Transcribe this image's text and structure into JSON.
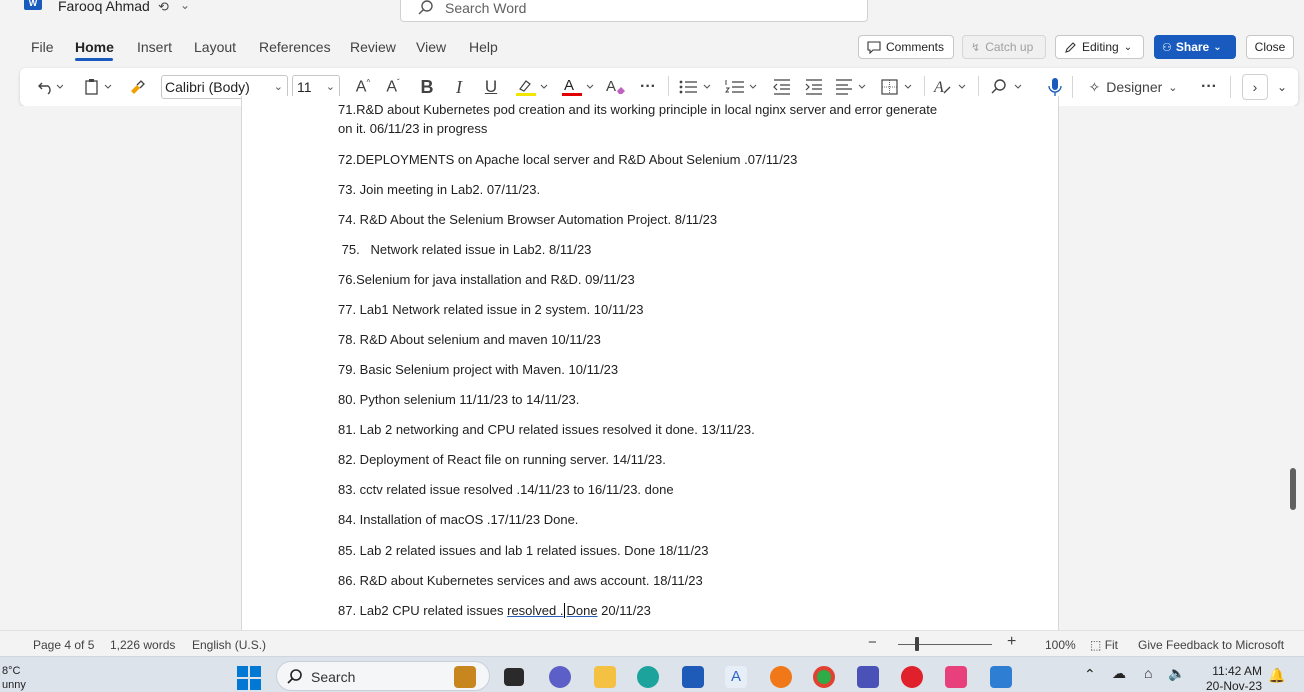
{
  "titlebar": {
    "user_name": "Farooq Ahmad",
    "search_placeholder": "Search Word"
  },
  "menu": {
    "tabs": [
      "File",
      "Home",
      "Insert",
      "Layout",
      "References",
      "Review",
      "View",
      "Help"
    ],
    "active": "Home",
    "comments_label": "Comments",
    "catchup_label": "Catch up",
    "editing_label": "Editing",
    "share_label": "Share",
    "close_label": "Close"
  },
  "ribbon": {
    "font_name": "Calibri (Body)",
    "font_size": "11",
    "designer_label": "Designer",
    "highlight_color": "#f2e600",
    "font_color": "#e00000"
  },
  "document": {
    "paragraphs": [
      "71.R&D about Kubernetes pod creation and its working principle in local nginx server and error generate",
      "on it. 06/11/23 in progress",
      "72.DEPLOYMENTS on Apache local server and R&D About Selenium .07/11/23",
      "73. Join meeting in Lab2. 07/11/23.",
      "74. R&D About the Selenium Browser Automation Project. 8/11/23",
      " 75.   Network related issue in Lab2. 8/11/23",
      "76.Selenium for java installation and R&D. 09/11/23",
      "77. Lab1 Network related issue in 2 system. 10/11/23",
      "78. R&D About selenium and maven 10/11/23",
      "79. Basic Selenium project with Maven. 10/11/23",
      "80. Python selenium 11/11/23 to 14/11/23.",
      "81. Lab 2 networking and CPU related issues resolved it done. 13/11/23.",
      "82. Deployment of React file on running server. 14/11/23.",
      "83. cctv related issue resolved .14/11/23 to 16/11/23. done",
      "84. Installation of macOS .17/11/23 Done.",
      "85. Lab 2 related issues and lab 1 related issues. Done 18/11/23",
      "86. R&D about Kubernetes services and aws account. 18/11/23"
    ],
    "last_para": {
      "prefix": "87. Lab2 CPU related issues ",
      "linked_a": "resolved .",
      "linked_b": "Done",
      "suffix": " 20/11/23"
    }
  },
  "statusbar": {
    "page": "Page 4 of 5",
    "words": "1,226 words",
    "language": "English (U.S.)",
    "zoom": "100%",
    "fit": "Fit",
    "feedback": "Give Feedback to Microsoft",
    "zoom_level": 0.2
  },
  "taskbar": {
    "weather_temp": "8°C",
    "weather_desc": "unny",
    "search_label": "Search",
    "time": "11:42 AM",
    "date": "20-Nov-23"
  }
}
